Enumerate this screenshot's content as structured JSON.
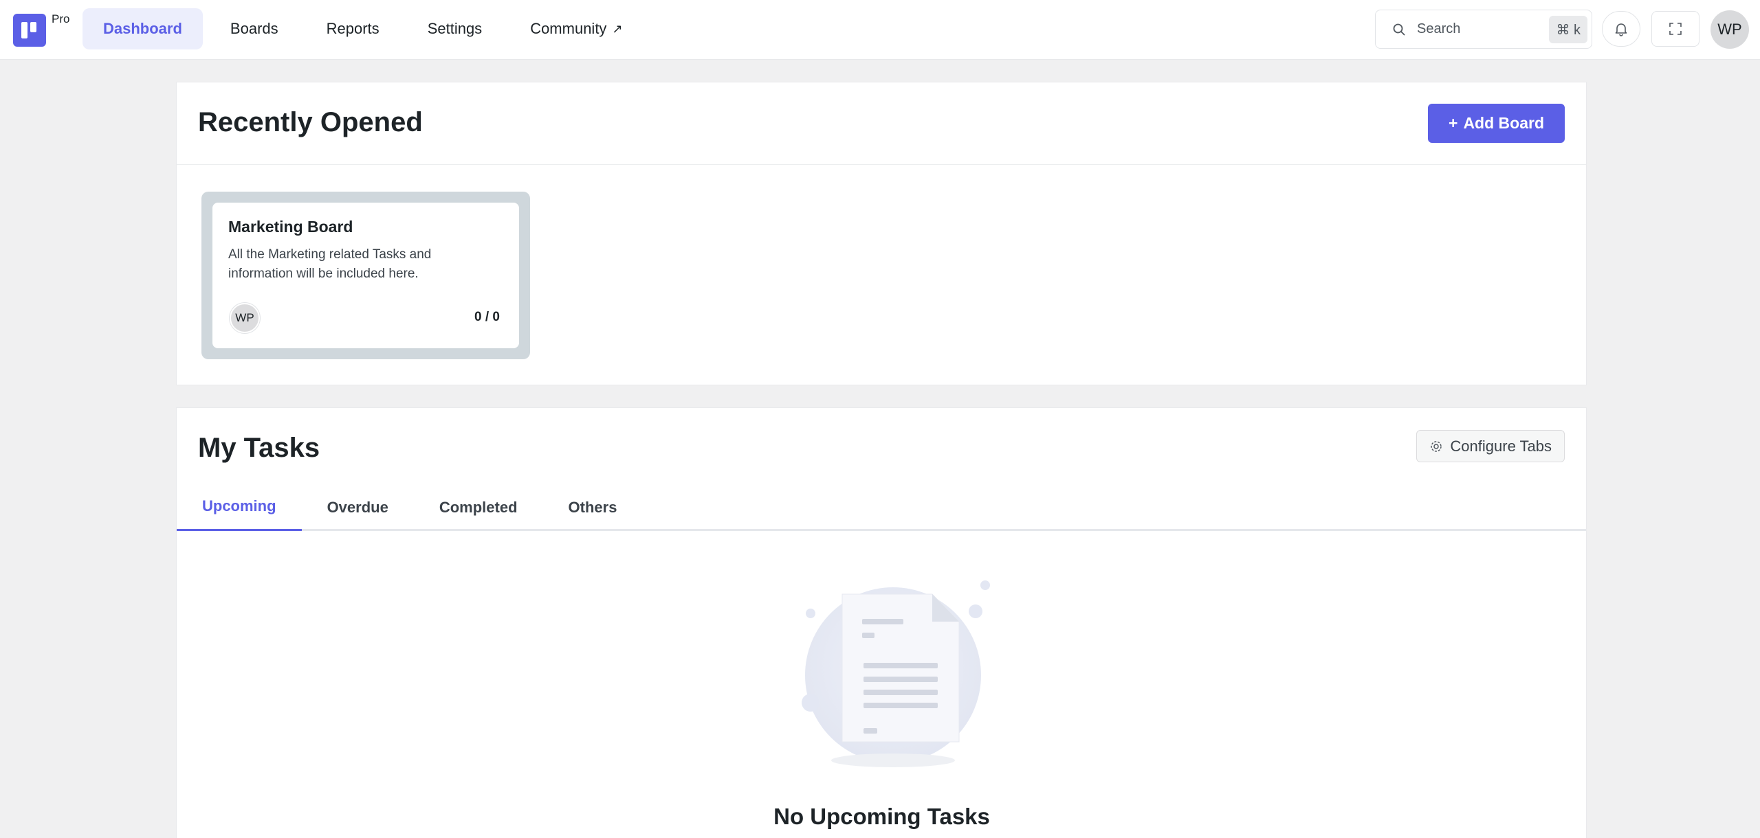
{
  "app": {
    "badge": "Pro"
  },
  "nav": {
    "items": [
      {
        "label": "Dashboard",
        "active": true
      },
      {
        "label": "Boards"
      },
      {
        "label": "Reports"
      },
      {
        "label": "Settings"
      },
      {
        "label": "Community",
        "external": true
      }
    ]
  },
  "search": {
    "placeholder": "Search",
    "shortcut": "⌘ k"
  },
  "user": {
    "initials": "WP"
  },
  "recent": {
    "title": "Recently Opened",
    "add_label": "Add Board",
    "boards": [
      {
        "title": "Marketing Board",
        "description": "All the Marketing related Tasks and information will be included here.",
        "member": "WP",
        "count": "0 / 0"
      }
    ]
  },
  "tasks": {
    "title": "My Tasks",
    "configure_label": "Configure Tabs",
    "tabs": [
      "Upcoming",
      "Overdue",
      "Completed",
      "Others"
    ],
    "active_tab": "Upcoming",
    "empty_title": "No Upcoming Tasks"
  },
  "colors": {
    "accent": "#5b5fe6",
    "accent_soft": "#eceefc"
  }
}
